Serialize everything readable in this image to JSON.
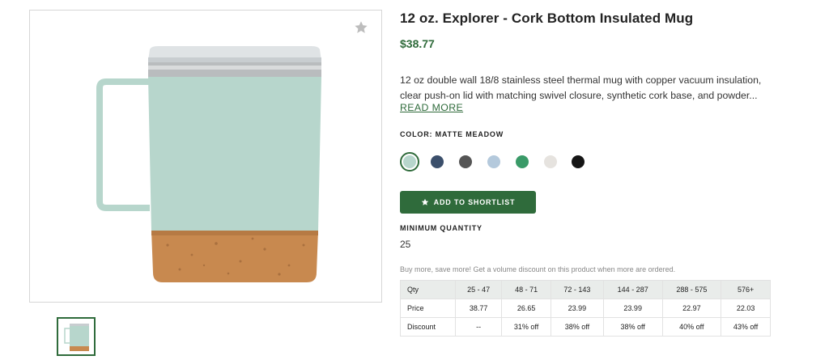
{
  "product": {
    "title": "12 oz. Explorer - Cork Bottom Insulated Mug",
    "price": "$38.77",
    "description": "12 oz double wall 18/8 stainless steel thermal mug with copper vacuum insulation, clear push-on lid with matching swivel closure, synthetic cork base, and powder...",
    "read_more": "READ MORE",
    "favorite_icon": "star-icon",
    "colors": {
      "label": "COLOR: MATTE MEADOW",
      "swatches": [
        {
          "name": "Matte Meadow",
          "hex": "#b7d6cc",
          "selected": true
        },
        {
          "name": "Navy",
          "hex": "#3b4f6b",
          "selected": false
        },
        {
          "name": "Charcoal",
          "hex": "#555555",
          "selected": false
        },
        {
          "name": "Light Blue",
          "hex": "#b4c9dc",
          "selected": false
        },
        {
          "name": "Green",
          "hex": "#3a9a68",
          "selected": false
        },
        {
          "name": "White",
          "hex": "#e6e3df",
          "selected": false
        },
        {
          "name": "Black",
          "hex": "#151515",
          "selected": false
        }
      ]
    },
    "shortlist_button": {
      "label": "ADD TO SHORTLIST",
      "icon": "star-icon"
    },
    "minimum_quantity": {
      "label": "MINIMUM QUANTITY",
      "value": "25"
    },
    "volume_note": "Buy more, save more! Get a volume discount on this product when more are ordered.",
    "pricing_table": {
      "headers": [
        "Qty",
        "25 - 47",
        "48 - 71",
        "72 - 143",
        "144 - 287",
        "288 - 575",
        "576+"
      ],
      "rows": [
        [
          "Price",
          "38.77",
          "26.65",
          "23.99",
          "23.99",
          "22.97",
          "22.03"
        ],
        [
          "Discount",
          "--",
          "31% off",
          "38% off",
          "38% off",
          "40% off",
          "43% off"
        ]
      ]
    }
  },
  "colors": {
    "accent": "#2f6b3b",
    "mug_body": "#b7d6cc",
    "cork": "#c8894f"
  }
}
